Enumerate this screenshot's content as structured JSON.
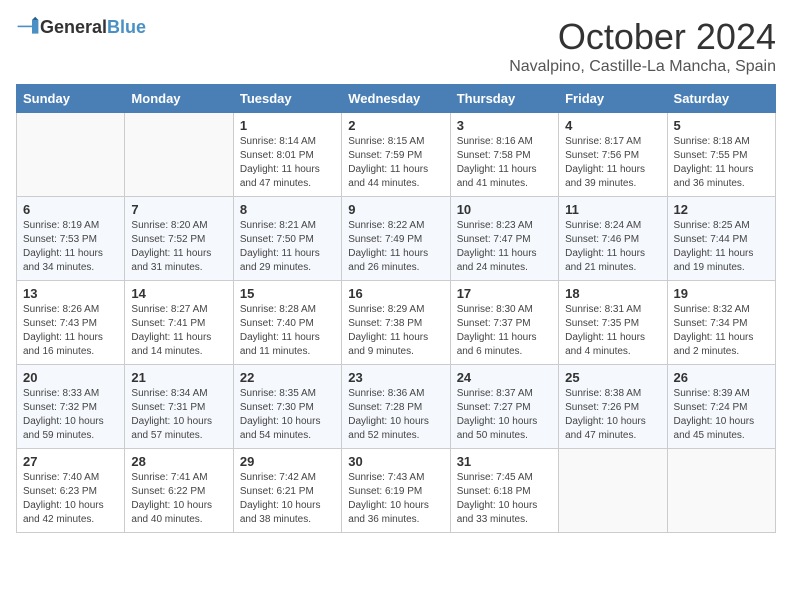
{
  "header": {
    "logo_general": "General",
    "logo_blue": "Blue",
    "month": "October 2024",
    "location": "Navalpino, Castille-La Mancha, Spain"
  },
  "weekdays": [
    "Sunday",
    "Monday",
    "Tuesday",
    "Wednesday",
    "Thursday",
    "Friday",
    "Saturday"
  ],
  "weeks": [
    [
      {
        "day": "",
        "info": ""
      },
      {
        "day": "",
        "info": ""
      },
      {
        "day": "1",
        "info": "Sunrise: 8:14 AM\nSunset: 8:01 PM\nDaylight: 11 hours and 47 minutes."
      },
      {
        "day": "2",
        "info": "Sunrise: 8:15 AM\nSunset: 7:59 PM\nDaylight: 11 hours and 44 minutes."
      },
      {
        "day": "3",
        "info": "Sunrise: 8:16 AM\nSunset: 7:58 PM\nDaylight: 11 hours and 41 minutes."
      },
      {
        "day": "4",
        "info": "Sunrise: 8:17 AM\nSunset: 7:56 PM\nDaylight: 11 hours and 39 minutes."
      },
      {
        "day": "5",
        "info": "Sunrise: 8:18 AM\nSunset: 7:55 PM\nDaylight: 11 hours and 36 minutes."
      }
    ],
    [
      {
        "day": "6",
        "info": "Sunrise: 8:19 AM\nSunset: 7:53 PM\nDaylight: 11 hours and 34 minutes."
      },
      {
        "day": "7",
        "info": "Sunrise: 8:20 AM\nSunset: 7:52 PM\nDaylight: 11 hours and 31 minutes."
      },
      {
        "day": "8",
        "info": "Sunrise: 8:21 AM\nSunset: 7:50 PM\nDaylight: 11 hours and 29 minutes."
      },
      {
        "day": "9",
        "info": "Sunrise: 8:22 AM\nSunset: 7:49 PM\nDaylight: 11 hours and 26 minutes."
      },
      {
        "day": "10",
        "info": "Sunrise: 8:23 AM\nSunset: 7:47 PM\nDaylight: 11 hours and 24 minutes."
      },
      {
        "day": "11",
        "info": "Sunrise: 8:24 AM\nSunset: 7:46 PM\nDaylight: 11 hours and 21 minutes."
      },
      {
        "day": "12",
        "info": "Sunrise: 8:25 AM\nSunset: 7:44 PM\nDaylight: 11 hours and 19 minutes."
      }
    ],
    [
      {
        "day": "13",
        "info": "Sunrise: 8:26 AM\nSunset: 7:43 PM\nDaylight: 11 hours and 16 minutes."
      },
      {
        "day": "14",
        "info": "Sunrise: 8:27 AM\nSunset: 7:41 PM\nDaylight: 11 hours and 14 minutes."
      },
      {
        "day": "15",
        "info": "Sunrise: 8:28 AM\nSunset: 7:40 PM\nDaylight: 11 hours and 11 minutes."
      },
      {
        "day": "16",
        "info": "Sunrise: 8:29 AM\nSunset: 7:38 PM\nDaylight: 11 hours and 9 minutes."
      },
      {
        "day": "17",
        "info": "Sunrise: 8:30 AM\nSunset: 7:37 PM\nDaylight: 11 hours and 6 minutes."
      },
      {
        "day": "18",
        "info": "Sunrise: 8:31 AM\nSunset: 7:35 PM\nDaylight: 11 hours and 4 minutes."
      },
      {
        "day": "19",
        "info": "Sunrise: 8:32 AM\nSunset: 7:34 PM\nDaylight: 11 hours and 2 minutes."
      }
    ],
    [
      {
        "day": "20",
        "info": "Sunrise: 8:33 AM\nSunset: 7:32 PM\nDaylight: 10 hours and 59 minutes."
      },
      {
        "day": "21",
        "info": "Sunrise: 8:34 AM\nSunset: 7:31 PM\nDaylight: 10 hours and 57 minutes."
      },
      {
        "day": "22",
        "info": "Sunrise: 8:35 AM\nSunset: 7:30 PM\nDaylight: 10 hours and 54 minutes."
      },
      {
        "day": "23",
        "info": "Sunrise: 8:36 AM\nSunset: 7:28 PM\nDaylight: 10 hours and 52 minutes."
      },
      {
        "day": "24",
        "info": "Sunrise: 8:37 AM\nSunset: 7:27 PM\nDaylight: 10 hours and 50 minutes."
      },
      {
        "day": "25",
        "info": "Sunrise: 8:38 AM\nSunset: 7:26 PM\nDaylight: 10 hours and 47 minutes."
      },
      {
        "day": "26",
        "info": "Sunrise: 8:39 AM\nSunset: 7:24 PM\nDaylight: 10 hours and 45 minutes."
      }
    ],
    [
      {
        "day": "27",
        "info": "Sunrise: 7:40 AM\nSunset: 6:23 PM\nDaylight: 10 hours and 42 minutes."
      },
      {
        "day": "28",
        "info": "Sunrise: 7:41 AM\nSunset: 6:22 PM\nDaylight: 10 hours and 40 minutes."
      },
      {
        "day": "29",
        "info": "Sunrise: 7:42 AM\nSunset: 6:21 PM\nDaylight: 10 hours and 38 minutes."
      },
      {
        "day": "30",
        "info": "Sunrise: 7:43 AM\nSunset: 6:19 PM\nDaylight: 10 hours and 36 minutes."
      },
      {
        "day": "31",
        "info": "Sunrise: 7:45 AM\nSunset: 6:18 PM\nDaylight: 10 hours and 33 minutes."
      },
      {
        "day": "",
        "info": ""
      },
      {
        "day": "",
        "info": ""
      }
    ]
  ]
}
